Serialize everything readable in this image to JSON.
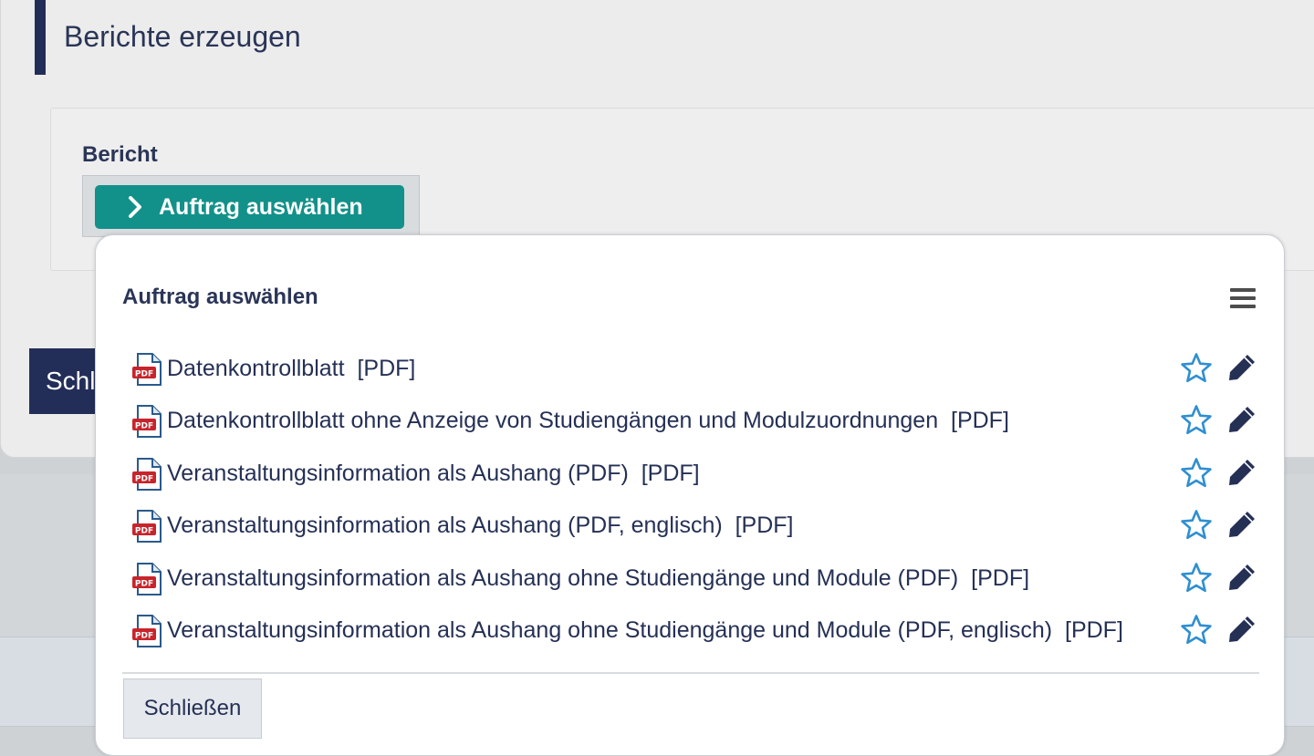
{
  "page": {
    "title": "Berichte erzeugen",
    "report_label": "Bericht",
    "select_button_label": "Auftrag auswählen",
    "close_button_label_partial": "Schl"
  },
  "popup": {
    "title": "Auftrag auswählen",
    "menu_icon": "hamburger-menu-icon",
    "items": [
      {
        "label": "Datenkontrollblatt",
        "format": "[PDF]"
      },
      {
        "label": "Datenkontrollblatt ohne Anzeige von Studiengängen und Modulzuordnungen",
        "format": "[PDF]"
      },
      {
        "label": "Veranstaltungsinformation als Aushang (PDF)",
        "format": "[PDF]"
      },
      {
        "label": "Veranstaltungsinformation als Aushang (PDF, englisch)",
        "format": "[PDF]"
      },
      {
        "label": "Veranstaltungsinformation als Aushang ohne Studiengänge und Module (PDF)",
        "format": "[PDF]"
      },
      {
        "label": "Veranstaltungsinformation als Aushang ohne Studiengänge und Module (PDF, englisch)",
        "format": "[PDF]"
      }
    ],
    "item_icons": {
      "type": "pdf-file-icon",
      "favorite": "star-icon",
      "edit": "pencil-icon"
    },
    "close_label": "Schließen"
  },
  "colors": {
    "primary_dark": "#232e58",
    "accent_teal": "#12918a",
    "star_blue": "#2f8fd1",
    "pdf_red": "#c8242b"
  }
}
